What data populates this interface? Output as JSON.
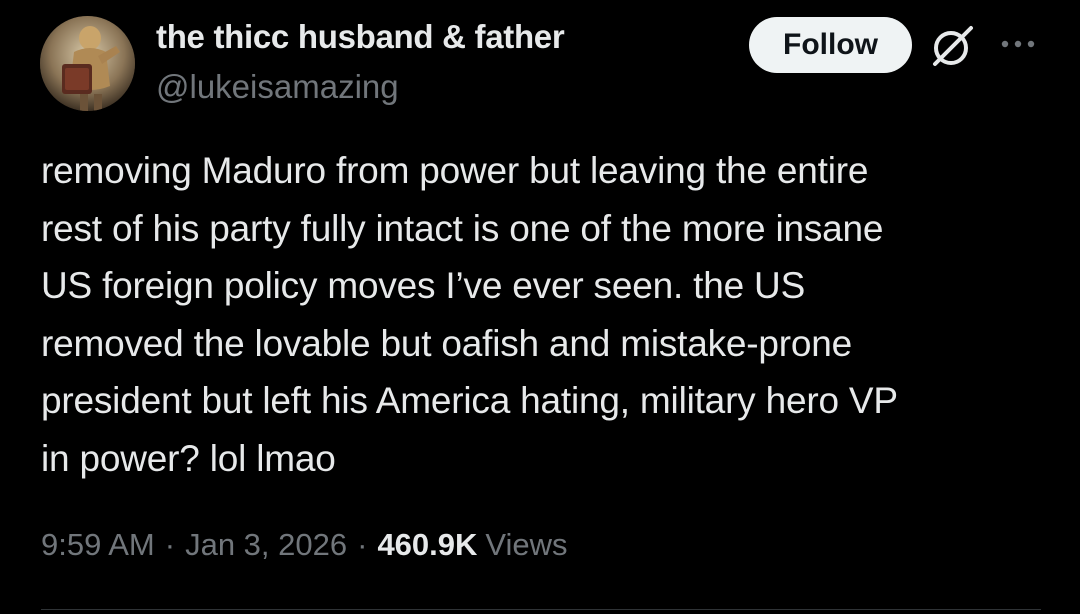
{
  "tweet": {
    "author": {
      "display_name": "the thicc husband & father",
      "handle": "@lukeisamazing",
      "avatar_icon": "avatar-image"
    },
    "follow_label": "Follow",
    "grok_icon": "grok-icon",
    "more_icon": "more-icon",
    "text": "removing Maduro from power but leaving the entire\nrest of his party fully intact is one of the more insane\nUS foreign policy moves I’ve ever seen. the US\nremoved the lovable but oafish and mistake-prone\npresident but left his America hating, military hero VP\nin power? lol lmao",
    "time": "9:59 AM",
    "separator": "·",
    "date": "Jan 3, 2026",
    "views_count": "460.9K",
    "views_label": "Views"
  },
  "colors": {
    "background": "#000000",
    "primary_text": "#e7e9ea",
    "secondary_text": "#71767b",
    "follow_bg": "#eff3f4",
    "follow_text": "#0f1419",
    "divider": "#2f3336"
  }
}
